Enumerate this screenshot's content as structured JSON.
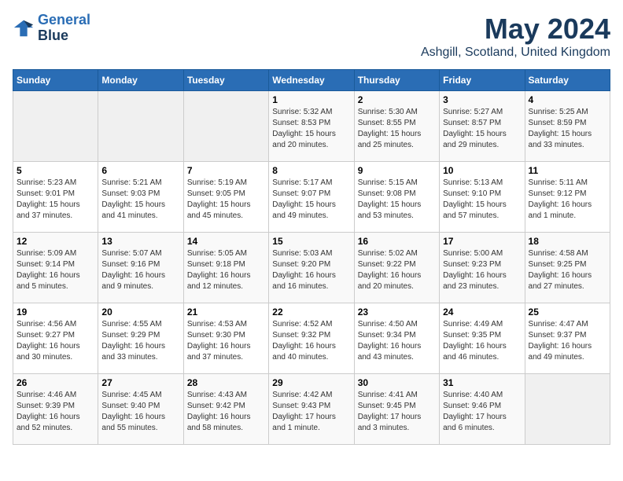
{
  "header": {
    "logo_line1": "General",
    "logo_line2": "Blue",
    "main_title": "May 2024",
    "subtitle": "Ashgill, Scotland, United Kingdom"
  },
  "days_of_week": [
    "Sunday",
    "Monday",
    "Tuesday",
    "Wednesday",
    "Thursday",
    "Friday",
    "Saturday"
  ],
  "weeks": [
    [
      {
        "day": "",
        "info": ""
      },
      {
        "day": "",
        "info": ""
      },
      {
        "day": "",
        "info": ""
      },
      {
        "day": "1",
        "info": "Sunrise: 5:32 AM\nSunset: 8:53 PM\nDaylight: 15 hours\nand 20 minutes."
      },
      {
        "day": "2",
        "info": "Sunrise: 5:30 AM\nSunset: 8:55 PM\nDaylight: 15 hours\nand 25 minutes."
      },
      {
        "day": "3",
        "info": "Sunrise: 5:27 AM\nSunset: 8:57 PM\nDaylight: 15 hours\nand 29 minutes."
      },
      {
        "day": "4",
        "info": "Sunrise: 5:25 AM\nSunset: 8:59 PM\nDaylight: 15 hours\nand 33 minutes."
      }
    ],
    [
      {
        "day": "5",
        "info": "Sunrise: 5:23 AM\nSunset: 9:01 PM\nDaylight: 15 hours\nand 37 minutes."
      },
      {
        "day": "6",
        "info": "Sunrise: 5:21 AM\nSunset: 9:03 PM\nDaylight: 15 hours\nand 41 minutes."
      },
      {
        "day": "7",
        "info": "Sunrise: 5:19 AM\nSunset: 9:05 PM\nDaylight: 15 hours\nand 45 minutes."
      },
      {
        "day": "8",
        "info": "Sunrise: 5:17 AM\nSunset: 9:07 PM\nDaylight: 15 hours\nand 49 minutes."
      },
      {
        "day": "9",
        "info": "Sunrise: 5:15 AM\nSunset: 9:08 PM\nDaylight: 15 hours\nand 53 minutes."
      },
      {
        "day": "10",
        "info": "Sunrise: 5:13 AM\nSunset: 9:10 PM\nDaylight: 15 hours\nand 57 minutes."
      },
      {
        "day": "11",
        "info": "Sunrise: 5:11 AM\nSunset: 9:12 PM\nDaylight: 16 hours\nand 1 minute."
      }
    ],
    [
      {
        "day": "12",
        "info": "Sunrise: 5:09 AM\nSunset: 9:14 PM\nDaylight: 16 hours\nand 5 minutes."
      },
      {
        "day": "13",
        "info": "Sunrise: 5:07 AM\nSunset: 9:16 PM\nDaylight: 16 hours\nand 9 minutes."
      },
      {
        "day": "14",
        "info": "Sunrise: 5:05 AM\nSunset: 9:18 PM\nDaylight: 16 hours\nand 12 minutes."
      },
      {
        "day": "15",
        "info": "Sunrise: 5:03 AM\nSunset: 9:20 PM\nDaylight: 16 hours\nand 16 minutes."
      },
      {
        "day": "16",
        "info": "Sunrise: 5:02 AM\nSunset: 9:22 PM\nDaylight: 16 hours\nand 20 minutes."
      },
      {
        "day": "17",
        "info": "Sunrise: 5:00 AM\nSunset: 9:23 PM\nDaylight: 16 hours\nand 23 minutes."
      },
      {
        "day": "18",
        "info": "Sunrise: 4:58 AM\nSunset: 9:25 PM\nDaylight: 16 hours\nand 27 minutes."
      }
    ],
    [
      {
        "day": "19",
        "info": "Sunrise: 4:56 AM\nSunset: 9:27 PM\nDaylight: 16 hours\nand 30 minutes."
      },
      {
        "day": "20",
        "info": "Sunrise: 4:55 AM\nSunset: 9:29 PM\nDaylight: 16 hours\nand 33 minutes."
      },
      {
        "day": "21",
        "info": "Sunrise: 4:53 AM\nSunset: 9:30 PM\nDaylight: 16 hours\nand 37 minutes."
      },
      {
        "day": "22",
        "info": "Sunrise: 4:52 AM\nSunset: 9:32 PM\nDaylight: 16 hours\nand 40 minutes."
      },
      {
        "day": "23",
        "info": "Sunrise: 4:50 AM\nSunset: 9:34 PM\nDaylight: 16 hours\nand 43 minutes."
      },
      {
        "day": "24",
        "info": "Sunrise: 4:49 AM\nSunset: 9:35 PM\nDaylight: 16 hours\nand 46 minutes."
      },
      {
        "day": "25",
        "info": "Sunrise: 4:47 AM\nSunset: 9:37 PM\nDaylight: 16 hours\nand 49 minutes."
      }
    ],
    [
      {
        "day": "26",
        "info": "Sunrise: 4:46 AM\nSunset: 9:39 PM\nDaylight: 16 hours\nand 52 minutes."
      },
      {
        "day": "27",
        "info": "Sunrise: 4:45 AM\nSunset: 9:40 PM\nDaylight: 16 hours\nand 55 minutes."
      },
      {
        "day": "28",
        "info": "Sunrise: 4:43 AM\nSunset: 9:42 PM\nDaylight: 16 hours\nand 58 minutes."
      },
      {
        "day": "29",
        "info": "Sunrise: 4:42 AM\nSunset: 9:43 PM\nDaylight: 17 hours\nand 1 minute."
      },
      {
        "day": "30",
        "info": "Sunrise: 4:41 AM\nSunset: 9:45 PM\nDaylight: 17 hours\nand 3 minutes."
      },
      {
        "day": "31",
        "info": "Sunrise: 4:40 AM\nSunset: 9:46 PM\nDaylight: 17 hours\nand 6 minutes."
      },
      {
        "day": "",
        "info": ""
      }
    ]
  ]
}
